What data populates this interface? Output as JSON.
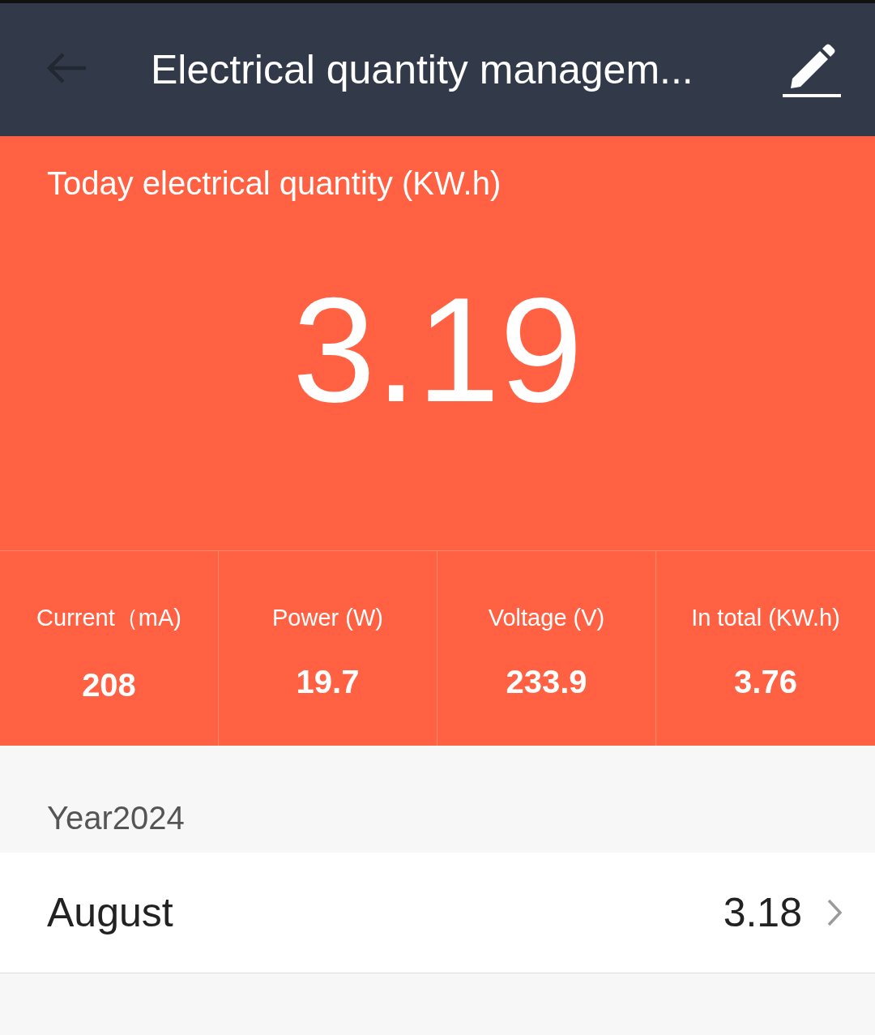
{
  "header": {
    "title": "Electrical quantity managem..."
  },
  "today": {
    "label": "Today electrical quantity (KW.h)",
    "value": "3.19"
  },
  "stats": [
    {
      "label": "Current（mA)",
      "value": "208"
    },
    {
      "label": "Power (W)",
      "value": "19.7"
    },
    {
      "label": "Voltage (V)",
      "value": "233.9"
    },
    {
      "label": "In total (KW.h)",
      "value": "3.76"
    }
  ],
  "year": "Year2024",
  "months": [
    {
      "name": "August",
      "value": "3.18"
    }
  ]
}
